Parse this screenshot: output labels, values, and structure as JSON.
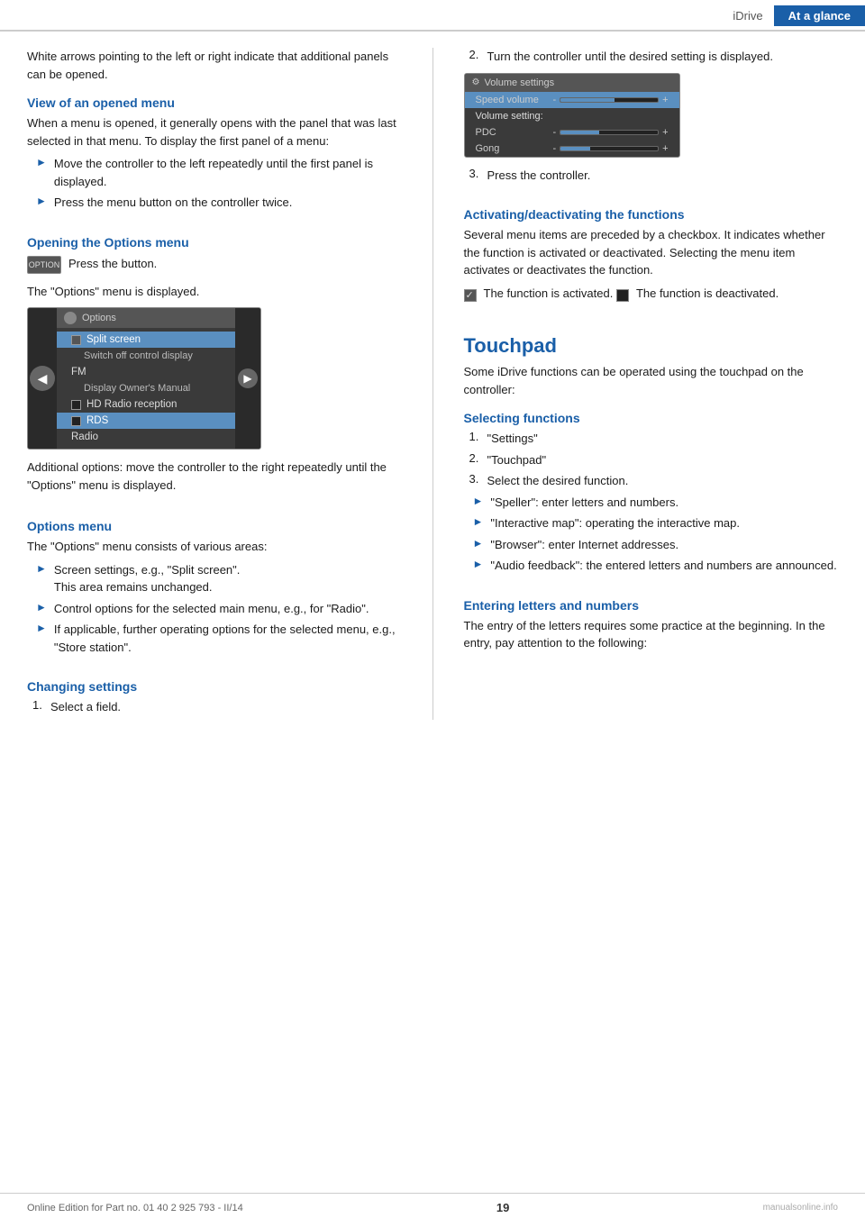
{
  "header": {
    "idrive_label": "iDrive",
    "ataglance_label": "At a glance"
  },
  "left_col": {
    "intro": "White arrows pointing to the left or right indicate that additional panels can be opened.",
    "view_opened_menu": {
      "title": "View of an opened menu",
      "body": "When a menu is opened, it generally opens with the panel that was last selected in that menu. To display the first panel of a menu:",
      "bullets": [
        "Move the controller to the left repeatedly until the first panel is displayed.",
        "Press the menu button on the controller twice."
      ]
    },
    "opening_options": {
      "title": "Opening the Options menu",
      "press_button": "Press the button.",
      "option_btn_label": "OPTION",
      "shown": "The \"Options\" menu is displayed.",
      "options_menu": {
        "title": "Options",
        "items": [
          {
            "label": "Split screen",
            "type": "check",
            "indent": false,
            "highlighted": true
          },
          {
            "label": "Switch off control display",
            "type": "normal",
            "indent": true,
            "highlighted": false
          },
          {
            "label": "FM",
            "type": "normal",
            "indent": false,
            "highlighted": false
          },
          {
            "label": "Display Owner's Manual",
            "type": "normal",
            "indent": true,
            "highlighted": false
          },
          {
            "label": "HD Radio reception",
            "type": "checkbox",
            "indent": false,
            "highlighted": false
          },
          {
            "label": "RDS",
            "type": "checkbox_hl",
            "indent": false,
            "highlighted": true
          },
          {
            "label": "Radio",
            "type": "normal",
            "indent": false,
            "highlighted": false
          }
        ]
      },
      "additional": "Additional options: move the controller to the right repeatedly until the \"Options\" menu is displayed."
    },
    "options_menu_section": {
      "title": "Options menu",
      "body": "The \"Options\" menu consists of various areas:",
      "bullets": [
        {
          "main": "Screen settings, e.g., \"Split screen\".",
          "sub": "This area remains unchanged."
        },
        {
          "main": "Control options for the selected main menu, e.g., for \"Radio\".",
          "sub": null
        },
        {
          "main": "If applicable, further operating options for the selected menu, e.g., \"Store station\".",
          "sub": null
        }
      ]
    },
    "changing_settings": {
      "title": "Changing settings",
      "steps": [
        "Select a field."
      ]
    }
  },
  "right_col": {
    "step2": "Turn the controller until the desired setting is displayed.",
    "step3": "Press the controller.",
    "volume_menu": {
      "title": "Volume settings",
      "items": [
        {
          "label": "Speed volume",
          "type": "highlighted",
          "bar": null
        },
        {
          "label": "Volume setting:",
          "type": "header",
          "bar": null
        },
        {
          "label": "PDC",
          "type": "bar",
          "bar": 40
        },
        {
          "label": "Gong",
          "type": "bar",
          "bar": 30
        }
      ]
    },
    "activating_section": {
      "title": "Activating/deactivating the functions",
      "body": "Several menu items are preceded by a checkbox. It indicates whether the function is activated or deactivated. Selecting the menu item activates or deactivates the function.",
      "activated_label": "The function is activated.",
      "deactivated_label": "The function is deactivated."
    },
    "touchpad_section": {
      "title": "Touchpad",
      "body": "Some iDrive functions can be operated using the touchpad on the controller:",
      "selecting_title": "Selecting functions",
      "selecting_steps": [
        "\"Settings\"",
        "\"Touchpad\"",
        "Select the desired function."
      ],
      "selecting_bullets": [
        "\"Speller\": enter letters and numbers.",
        "\"Interactive map\": operating the interactive map.",
        "\"Browser\": enter Internet addresses.",
        "\"Audio feedback\": the entered letters and numbers are announced."
      ],
      "entering_title": "Entering letters and numbers",
      "entering_body": "The entry of the letters requires some practice at the beginning. In the entry, pay attention to the following:"
    }
  },
  "footer": {
    "edition": "Online Edition for Part no. 01 40 2 925 793 - II/14",
    "page": "19",
    "watermark": "manualsonline.info"
  }
}
